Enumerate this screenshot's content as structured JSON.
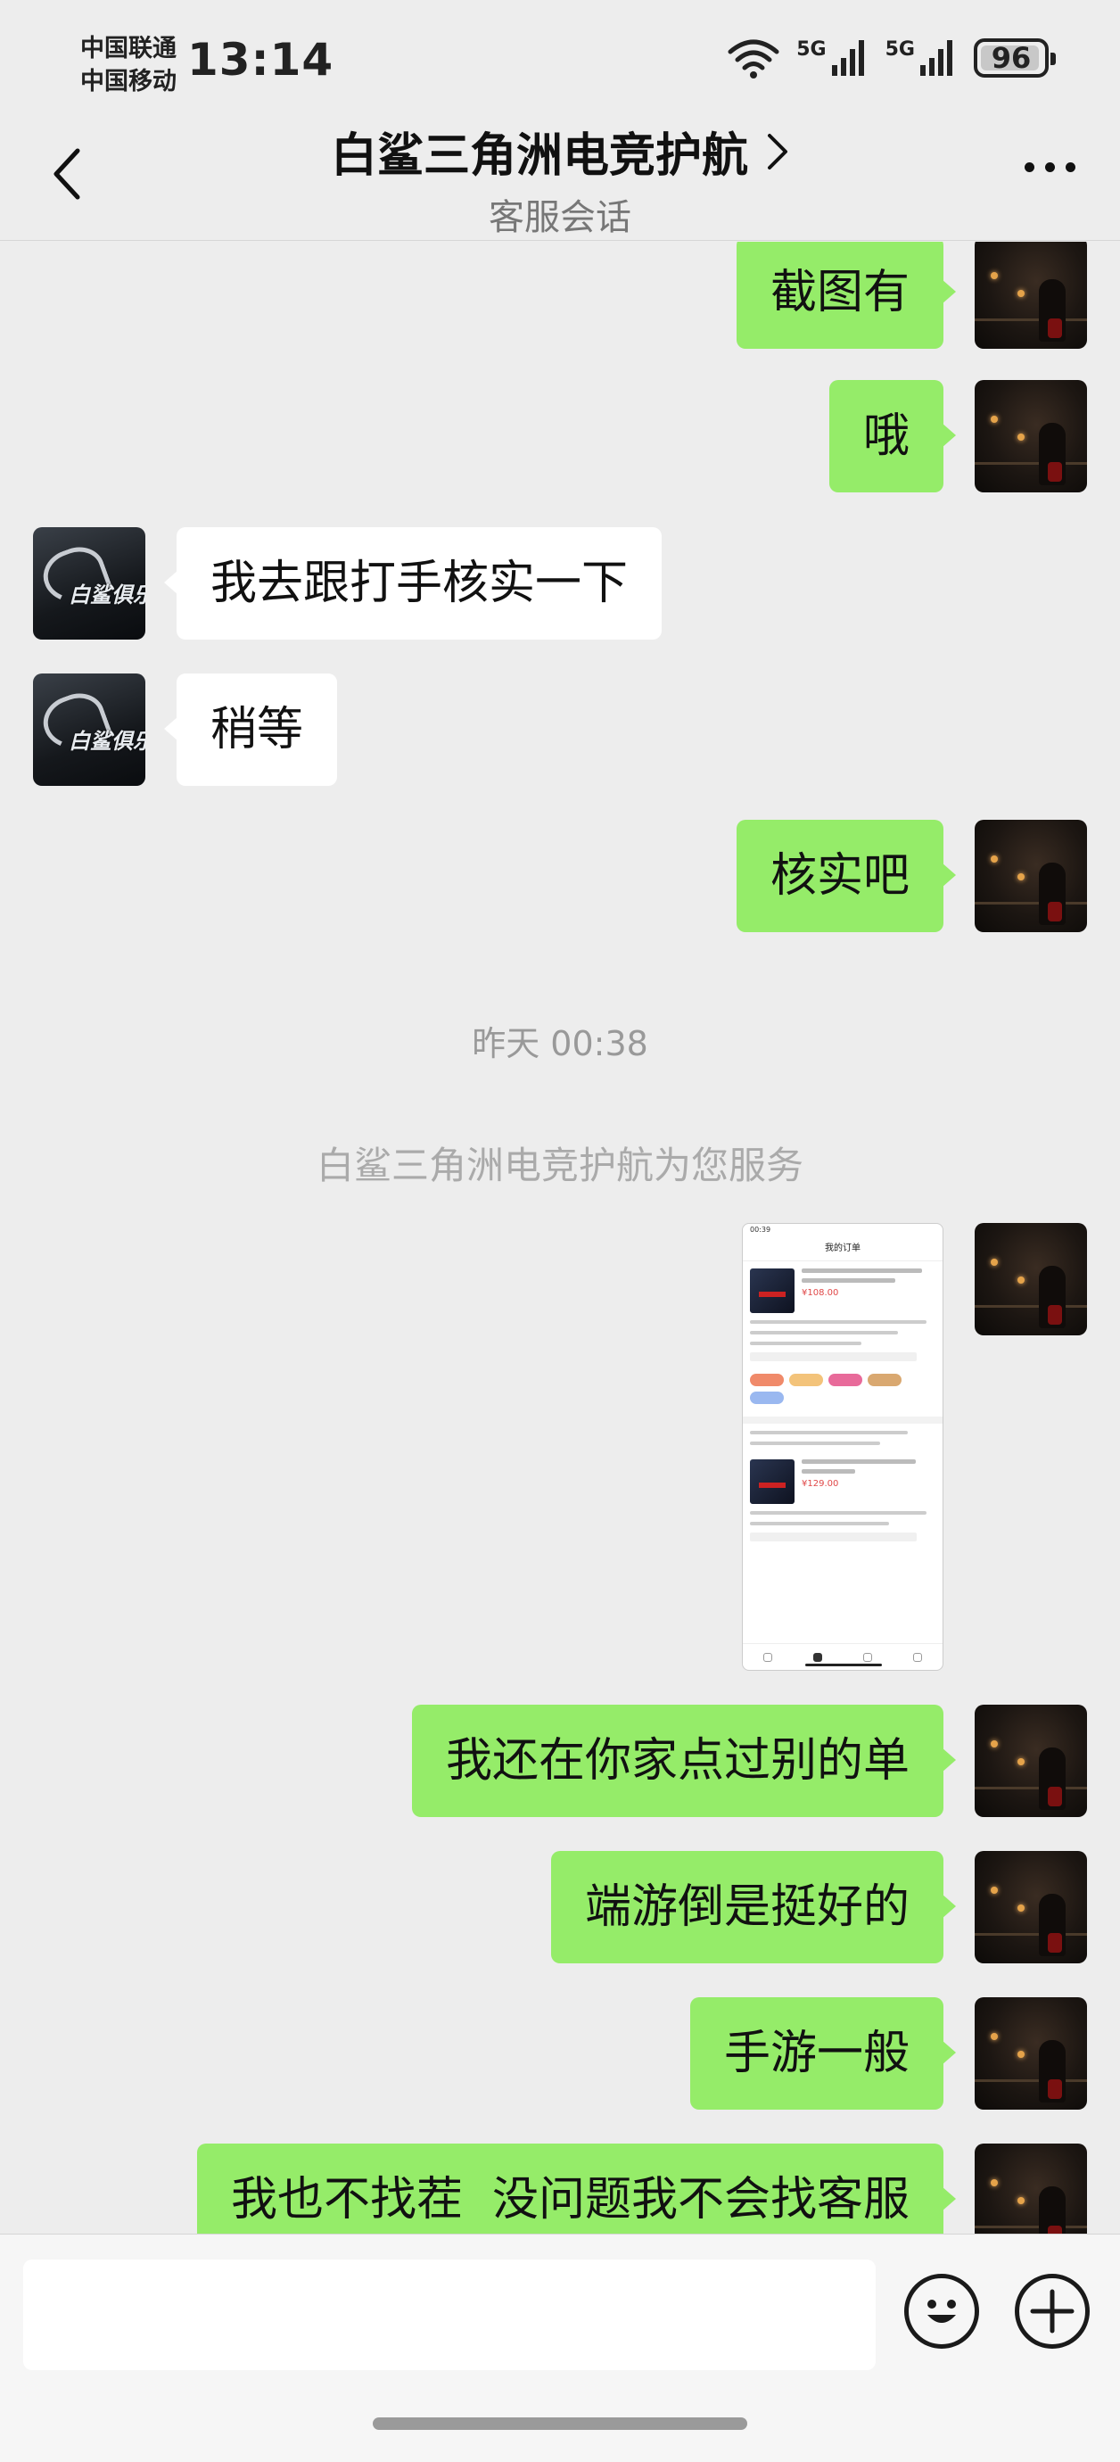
{
  "status_bar": {
    "carrier_1": "中国联通",
    "carrier_2": "中国移动",
    "time": "13:14",
    "net_1": "5G",
    "net_2": "5G",
    "battery": "96",
    "battery_level_percent": 96
  },
  "header": {
    "title": "白鲨三角洲电竞护航",
    "subtitle": "客服会话"
  },
  "avatar_text": "白鲨俱乐部",
  "messages": [
    {
      "sender": "me",
      "text": "截图有"
    },
    {
      "sender": "me",
      "text": "哦"
    },
    {
      "sender": "other",
      "text": "我去跟打手核实一下"
    },
    {
      "sender": "other",
      "text": "稍等"
    },
    {
      "sender": "me",
      "text": "核实吧"
    },
    {
      "type": "time",
      "text": "昨天 00:38"
    },
    {
      "type": "system",
      "text": "白鲨三角洲电竞护航为您服务"
    },
    {
      "sender": "me",
      "type": "image"
    },
    {
      "sender": "me",
      "text": "我还在你家点过别的单"
    },
    {
      "sender": "me",
      "text": "端游倒是挺好的"
    },
    {
      "sender": "me",
      "text": "手游一般"
    },
    {
      "sender": "me",
      "text": "我也不找茬  没问题我不会找客服"
    }
  ],
  "thumbnail": {
    "time": "00:39",
    "title": "我的订单",
    "price_1": "¥108.00",
    "price_2": "¥129.00"
  },
  "colors": {
    "my_bubble": "#95ec69",
    "other_bubble": "#ffffff",
    "background": "#ededed"
  }
}
